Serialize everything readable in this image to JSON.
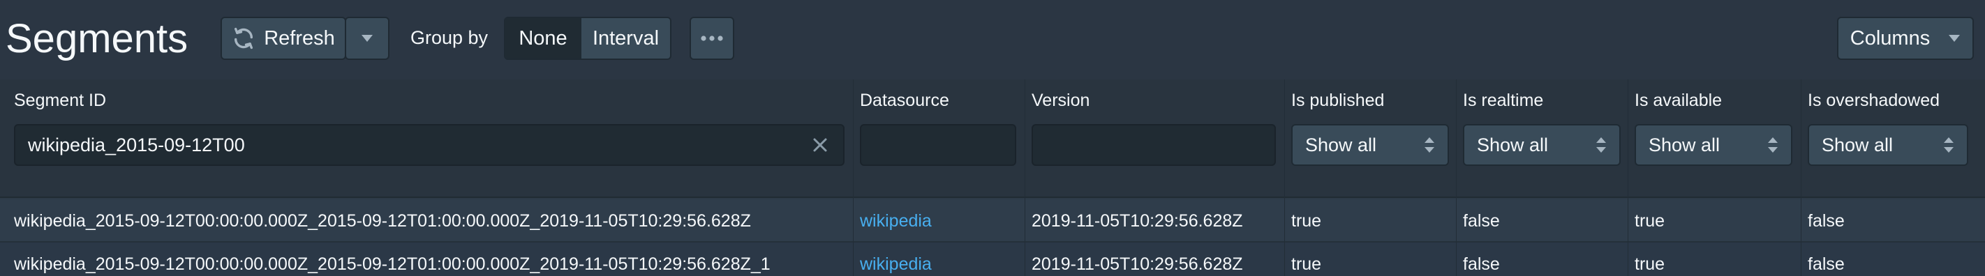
{
  "header": {
    "title": "Segments",
    "refresh_label": "Refresh",
    "group_by_label": "Group by",
    "group_options": [
      "None",
      "Interval"
    ],
    "group_selected": "None",
    "more_icon": "ellipsis-icon",
    "columns_label": "Columns"
  },
  "table": {
    "columns": [
      "Segment ID",
      "Datasource",
      "Version",
      "Is published",
      "Is realtime",
      "Is available",
      "Is overshadowed"
    ],
    "filters": {
      "segment_id": "wikipedia_2015-09-12T00",
      "datasource": "",
      "version": "",
      "is_published": "Show all",
      "is_realtime": "Show all",
      "is_available": "Show all",
      "is_overshadowed": "Show all"
    },
    "rows": [
      {
        "segment_id": "wikipedia_2015-09-12T00:00:00.000Z_2015-09-12T01:00:00.000Z_2019-11-05T10:29:56.628Z",
        "datasource": "wikipedia",
        "version": "2019-11-05T10:29:56.628Z",
        "is_published": "true",
        "is_realtime": "false",
        "is_available": "true",
        "is_overshadowed": "false"
      },
      {
        "segment_id": "wikipedia_2015-09-12T00:00:00.000Z_2015-09-12T01:00:00.000Z_2019-11-05T10:29:56.628Z_1",
        "datasource": "wikipedia",
        "version": "2019-11-05T10:29:56.628Z",
        "is_published": "true",
        "is_realtime": "false",
        "is_available": "true",
        "is_overshadowed": "false"
      }
    ]
  },
  "colors": {
    "background": "#2b3643",
    "link": "#48aff0",
    "button": "#394b59",
    "input": "#202b33"
  }
}
